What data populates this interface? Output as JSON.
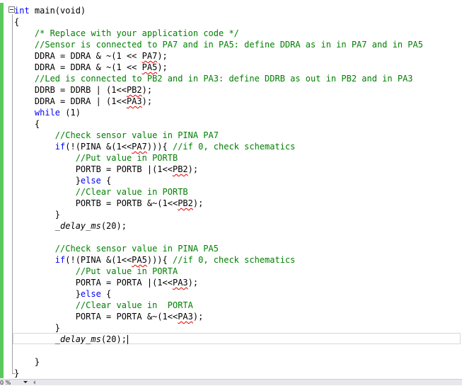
{
  "editor": {
    "lines": [
      [
        {
          "t": "int",
          "c": "kw"
        },
        {
          "t": " main(void)",
          "c": "tx"
        }
      ],
      [
        {
          "t": "{",
          "c": "tx"
        }
      ],
      [
        {
          "t": "    ",
          "c": "tx"
        },
        {
          "t": "/* Replace with your application code */",
          "c": "cm"
        }
      ],
      [
        {
          "t": "    ",
          "c": "tx"
        },
        {
          "t": "//Sensor is connected to PA7 and in PA5: define DDRA as in in PA7 and in PA5",
          "c": "cm"
        }
      ],
      [
        {
          "t": "    DDRA = DDRA & ~(1 << ",
          "c": "tx"
        },
        {
          "t": "PA7",
          "c": "tx sq"
        },
        {
          "t": ");",
          "c": "tx"
        }
      ],
      [
        {
          "t": "    DDRA = DDRA & ~(1 << ",
          "c": "tx"
        },
        {
          "t": "PA5",
          "c": "tx sq"
        },
        {
          "t": ");",
          "c": "tx"
        }
      ],
      [
        {
          "t": "    ",
          "c": "tx"
        },
        {
          "t": "//Led is connected to PB2 and in PA3: define DDRB as out in PB2 and in PA3",
          "c": "cm"
        }
      ],
      [
        {
          "t": "    DDRB = DDRB | (1<<",
          "c": "tx"
        },
        {
          "t": "PB2",
          "c": "tx sq"
        },
        {
          "t": ");",
          "c": "tx"
        }
      ],
      [
        {
          "t": "    DDRA = DDRA | (1<<",
          "c": "tx"
        },
        {
          "t": "PA3",
          "c": "tx sq"
        },
        {
          "t": ");",
          "c": "tx"
        }
      ],
      [
        {
          "t": "    ",
          "c": "tx"
        },
        {
          "t": "while",
          "c": "kw"
        },
        {
          "t": " (1)",
          "c": "tx"
        }
      ],
      [
        {
          "t": "    {",
          "c": "tx"
        }
      ],
      [
        {
          "t": "        ",
          "c": "tx"
        },
        {
          "t": "//Check sensor value in PINA PA7",
          "c": "cm"
        }
      ],
      [
        {
          "t": "        ",
          "c": "tx"
        },
        {
          "t": "if",
          "c": "kw"
        },
        {
          "t": "(!(PINA &(1<<",
          "c": "tx"
        },
        {
          "t": "PA7",
          "c": "tx sq"
        },
        {
          "t": "))){ ",
          "c": "tx"
        },
        {
          "t": "//if 0, check schematics",
          "c": "cm"
        }
      ],
      [
        {
          "t": "            ",
          "c": "tx"
        },
        {
          "t": "//Put value in PORTB",
          "c": "cm"
        }
      ],
      [
        {
          "t": "            PORTB = PORTB |(1<<",
          "c": "tx"
        },
        {
          "t": "PB2",
          "c": "tx sq"
        },
        {
          "t": ");",
          "c": "tx"
        }
      ],
      [
        {
          "t": "            }",
          "c": "tx"
        },
        {
          "t": "else",
          "c": "kw"
        },
        {
          "t": " {",
          "c": "tx"
        }
      ],
      [
        {
          "t": "            ",
          "c": "tx"
        },
        {
          "t": "//Clear value in PORTB",
          "c": "cm"
        }
      ],
      [
        {
          "t": "            PORTB = PORTB &~(1<<",
          "c": "tx"
        },
        {
          "t": "PB2",
          "c": "tx sq"
        },
        {
          "t": ");",
          "c": "tx"
        }
      ],
      [
        {
          "t": "        }",
          "c": "tx"
        }
      ],
      [
        {
          "t": "        ",
          "c": "tx"
        },
        {
          "t": "_delay_ms",
          "c": "fn"
        },
        {
          "t": "(20);",
          "c": "tx"
        }
      ],
      [
        {
          "t": "",
          "c": "tx"
        }
      ],
      [
        {
          "t": "        ",
          "c": "tx"
        },
        {
          "t": "//Check sensor value in PINA PA5",
          "c": "cm"
        }
      ],
      [
        {
          "t": "        ",
          "c": "tx"
        },
        {
          "t": "if",
          "c": "kw"
        },
        {
          "t": "(!(PINA &(1<<",
          "c": "tx"
        },
        {
          "t": "PA5",
          "c": "tx sq"
        },
        {
          "t": "))){ ",
          "c": "tx"
        },
        {
          "t": "//if 0, check schematics",
          "c": "cm"
        }
      ],
      [
        {
          "t": "            ",
          "c": "tx"
        },
        {
          "t": "//Put value in PORTA",
          "c": "cm"
        }
      ],
      [
        {
          "t": "            PORTA = PORTA |(1<<",
          "c": "tx"
        },
        {
          "t": "PA3",
          "c": "tx sq"
        },
        {
          "t": ");",
          "c": "tx"
        }
      ],
      [
        {
          "t": "            }",
          "c": "tx"
        },
        {
          "t": "else",
          "c": "kw"
        },
        {
          "t": " {",
          "c": "tx"
        }
      ],
      [
        {
          "t": "            ",
          "c": "tx"
        },
        {
          "t": "//Clear value in  PORTA",
          "c": "cm"
        }
      ],
      [
        {
          "t": "            PORTA = PORTA &~(1<<",
          "c": "tx"
        },
        {
          "t": "PA3",
          "c": "tx sq"
        },
        {
          "t": ");",
          "c": "tx"
        }
      ],
      [
        {
          "t": "        }",
          "c": "tx"
        }
      ],
      [
        {
          "t": "        ",
          "c": "tx"
        },
        {
          "t": "_delay_ms",
          "c": "fn"
        },
        {
          "t": "(20);",
          "c": "tx"
        }
      ],
      [
        {
          "t": "",
          "c": "tx"
        }
      ],
      [
        {
          "t": "    }",
          "c": "tx"
        }
      ],
      [
        {
          "t": "}",
          "c": "tx"
        }
      ]
    ],
    "caret_line": 29
  },
  "statusbar": {
    "zoom": "0 %"
  },
  "colors": {
    "keyword": "#0000ff",
    "comment": "#008000",
    "squiggle": "#e00000",
    "margin_bar": "#5cc95c"
  }
}
